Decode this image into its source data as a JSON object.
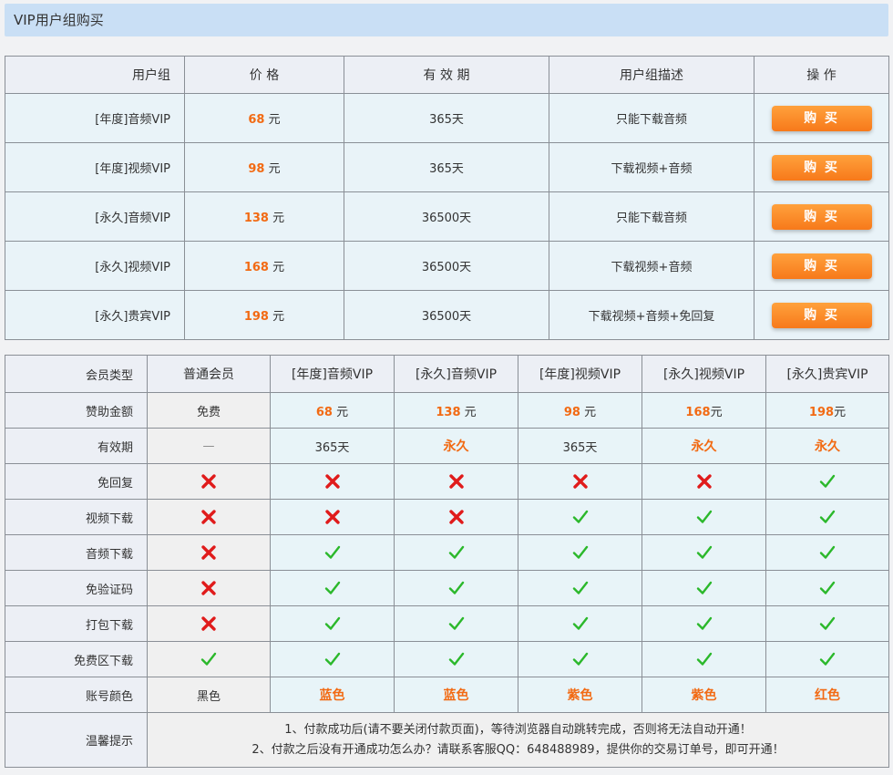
{
  "page": {
    "title": "VIP用户组购买"
  },
  "purchase": {
    "headers": [
      "用户组",
      "价 格",
      "有 效 期",
      "用户组描述",
      "操 作"
    ],
    "currency": "元",
    "buy_label": "购 买",
    "rows": [
      {
        "group": "[年度]音频VIP",
        "price": "68",
        "period": "365天",
        "desc": "只能下载音频"
      },
      {
        "group": "[年度]视频VIP",
        "price": "98",
        "period": "365天",
        "desc": "下载视频+音频"
      },
      {
        "group": "[永久]音频VIP",
        "price": "138",
        "period": "36500天",
        "desc": "只能下载音频"
      },
      {
        "group": "[永久]视频VIP",
        "price": "168",
        "period": "36500天",
        "desc": "下载视频+音频"
      },
      {
        "group": "[永久]贵宾VIP",
        "price": "198",
        "period": "36500天",
        "desc": "下载视频+音频+免回复"
      }
    ]
  },
  "compare": {
    "type_label": "会员类型",
    "columns": [
      "普通会员",
      "[年度]音频VIP",
      "[永久]音频VIP",
      "[年度]视频VIP",
      "[永久]视频VIP",
      "[永久]贵宾VIP"
    ],
    "sponsor": {
      "label": "赞助金额",
      "normal": "免费",
      "amounts": [
        {
          "num": "68",
          "unit": " 元"
        },
        {
          "num": "138",
          "unit": " 元"
        },
        {
          "num": "98",
          "unit": " 元"
        },
        {
          "num": "168",
          "unit": "元"
        },
        {
          "num": "198",
          "unit": "元"
        }
      ]
    },
    "validity": {
      "label": "有效期",
      "values": [
        "—",
        "365天",
        "永久",
        "365天",
        "永久",
        "永久"
      ]
    },
    "features": [
      {
        "label": "免回复",
        "values": [
          false,
          false,
          false,
          false,
          false,
          true
        ]
      },
      {
        "label": "视频下载",
        "values": [
          false,
          false,
          false,
          true,
          true,
          true
        ]
      },
      {
        "label": "音频下载",
        "values": [
          false,
          true,
          true,
          true,
          true,
          true
        ]
      },
      {
        "label": "免验证码",
        "values": [
          false,
          true,
          true,
          true,
          true,
          true
        ]
      },
      {
        "label": "打包下载",
        "values": [
          false,
          true,
          true,
          true,
          true,
          true
        ]
      },
      {
        "label": "免费区下载",
        "values": [
          true,
          true,
          true,
          true,
          true,
          true
        ]
      }
    ],
    "color_row": {
      "label": "账号颜色",
      "values": [
        "黑色",
        "蓝色",
        "蓝色",
        "紫色",
        "紫色",
        "红色"
      ]
    },
    "tips": {
      "label": "温馨提示",
      "lines": [
        "1、付款成功后(请不要关闭付款页面)，等待浏览器自动跳转完成，否则将无法自动开通！",
        "2、付款之后没有开通成功怎么办？请联系客服QQ：648488989，提供你的交易订单号，即可开通！"
      ]
    }
  },
  "colors": {
    "accent_orange": "#f26a13",
    "check_green": "#2bb82b",
    "cross_red": "#e01b1b",
    "title_bg": "#c9dff5"
  }
}
